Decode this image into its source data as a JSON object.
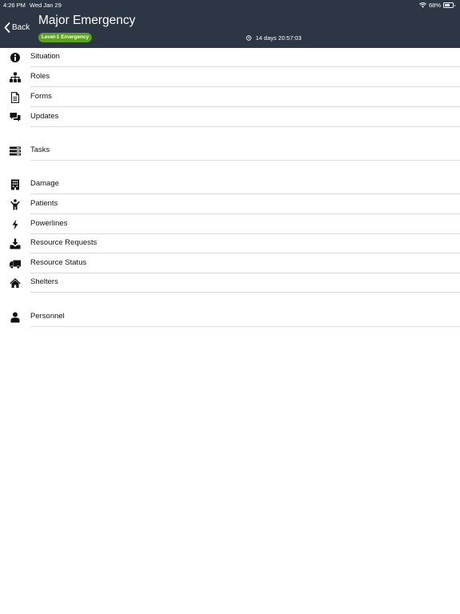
{
  "status_bar": {
    "time": "4:26 PM",
    "date": "Wed Jan 29",
    "battery": "68%"
  },
  "header": {
    "back_label": "Back",
    "title": "Major Emergency",
    "badge": "Level-1 Emergency",
    "timer": "14 days 20:57:03"
  },
  "colors": {
    "header_bg": "#2c3644",
    "badge_bg": "#5ba31e"
  },
  "menu": {
    "group1": [
      {
        "label": "Situation",
        "icon": "info-circle-icon"
      },
      {
        "label": "Roles",
        "icon": "org-chart-icon"
      },
      {
        "label": "Forms",
        "icon": "document-icon"
      },
      {
        "label": "Updates",
        "icon": "chat-bubbles-icon"
      }
    ],
    "group2": [
      {
        "label": "Tasks",
        "icon": "tasks-icon"
      }
    ],
    "group3": [
      {
        "label": "Damage",
        "icon": "building-icon"
      },
      {
        "label": "Patients",
        "icon": "patient-icon"
      },
      {
        "label": "Powerlines",
        "icon": "lightning-icon"
      },
      {
        "label": "Resource Requests",
        "icon": "download-tray-icon"
      },
      {
        "label": "Resource Status",
        "icon": "truck-icon"
      },
      {
        "label": "Shelters",
        "icon": "house-icon"
      }
    ],
    "group4": [
      {
        "label": "Personnel",
        "icon": "person-icon"
      }
    ]
  }
}
